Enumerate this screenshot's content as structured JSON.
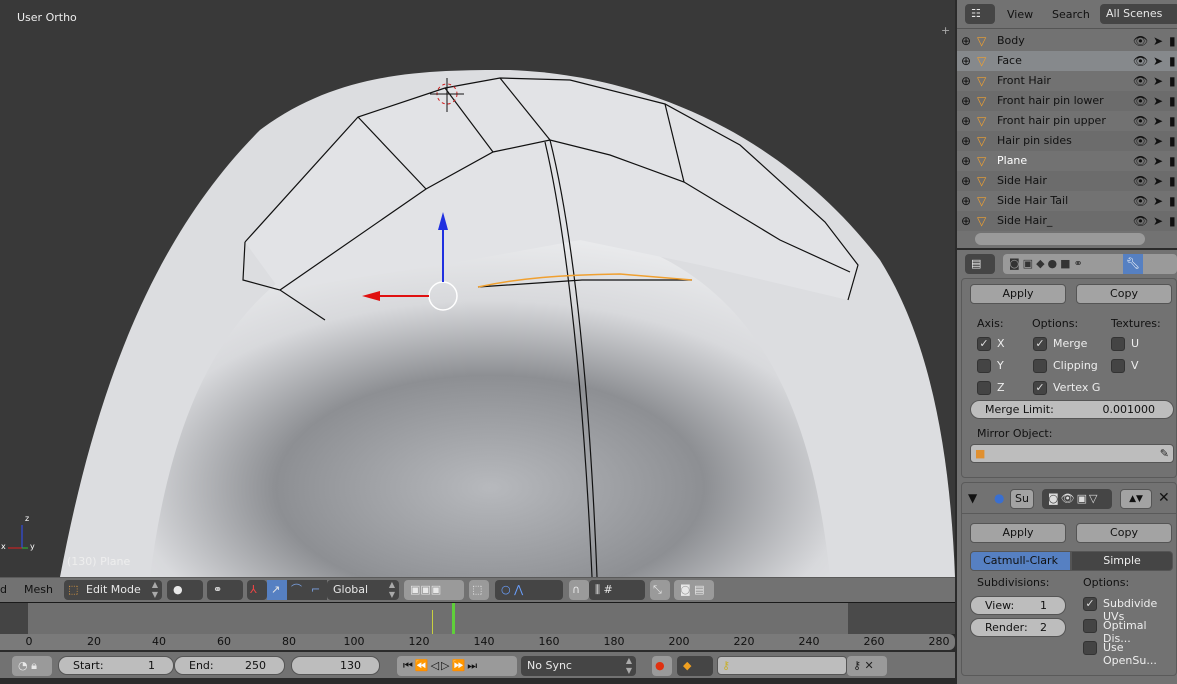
{
  "viewport": {
    "view_label": "User Ortho",
    "object_label": "(130) Plane",
    "axis_labels": {
      "x": "x",
      "y": "y",
      "z": "z"
    }
  },
  "view3d_header": {
    "menu_partial": "d",
    "mesh_menu": "Mesh",
    "mode": "Edit Mode",
    "orientation": "Global"
  },
  "timeline": {
    "ticks": [
      "0",
      "20",
      "40",
      "60",
      "80",
      "100",
      "120",
      "140",
      "160",
      "180",
      "200",
      "220",
      "240",
      "260",
      "280"
    ],
    "current_frame_marker": 130,
    "start": "1",
    "end": "250",
    "current": "130",
    "start_label": "Start:",
    "end_label": "End:",
    "sync": "No Sync"
  },
  "outliner": {
    "view_menu": "View",
    "search_menu": "Search",
    "scene_filter": "All Scenes",
    "items": [
      {
        "name": "Body"
      },
      {
        "name": "Face"
      },
      {
        "name": "Front Hair"
      },
      {
        "name": "Front hair pin lower"
      },
      {
        "name": "Front hair pin upper"
      },
      {
        "name": "Hair pin sides"
      },
      {
        "name": "Plane"
      },
      {
        "name": "Side Hair"
      },
      {
        "name": "Side Hair Tail"
      },
      {
        "name": "Side Hair_"
      }
    ]
  },
  "mirror_modifier": {
    "apply": "Apply",
    "copy": "Copy",
    "axis_label": "Axis:",
    "options_label": "Options:",
    "textures_label": "Textures:",
    "axis": [
      {
        "label": "X",
        "checked": true
      },
      {
        "label": "Y",
        "checked": false
      },
      {
        "label": "Z",
        "checked": false
      }
    ],
    "options": [
      {
        "label": "Merge",
        "checked": true
      },
      {
        "label": "Clipping",
        "checked": false
      },
      {
        "label": "Vertex G",
        "checked": true
      }
    ],
    "textures": [
      {
        "label": "U",
        "checked": false
      },
      {
        "label": "V",
        "checked": false
      }
    ],
    "merge_limit_label": "Merge Limit:",
    "merge_limit": "0.001000",
    "mirror_object_label": "Mirror Object:"
  },
  "subsurf_modifier": {
    "name": "Su",
    "apply": "Apply",
    "copy": "Copy",
    "type_catmull": "Catmull-Clark",
    "type_simple": "Simple",
    "subdivisions_label": "Subdivisions:",
    "options_label": "Options:",
    "view_label": "View:",
    "view": "1",
    "render_label": "Render:",
    "render": "2",
    "options": [
      {
        "label": "Subdivide UVs",
        "checked": true
      },
      {
        "label": "Optimal Dis...",
        "checked": false
      },
      {
        "label": "Use OpenSu...",
        "checked": false
      }
    ]
  },
  "colors": {
    "accent": "#5680c2",
    "timeline_current": "#5fcf3a",
    "selected_edge": "#f0a030"
  }
}
